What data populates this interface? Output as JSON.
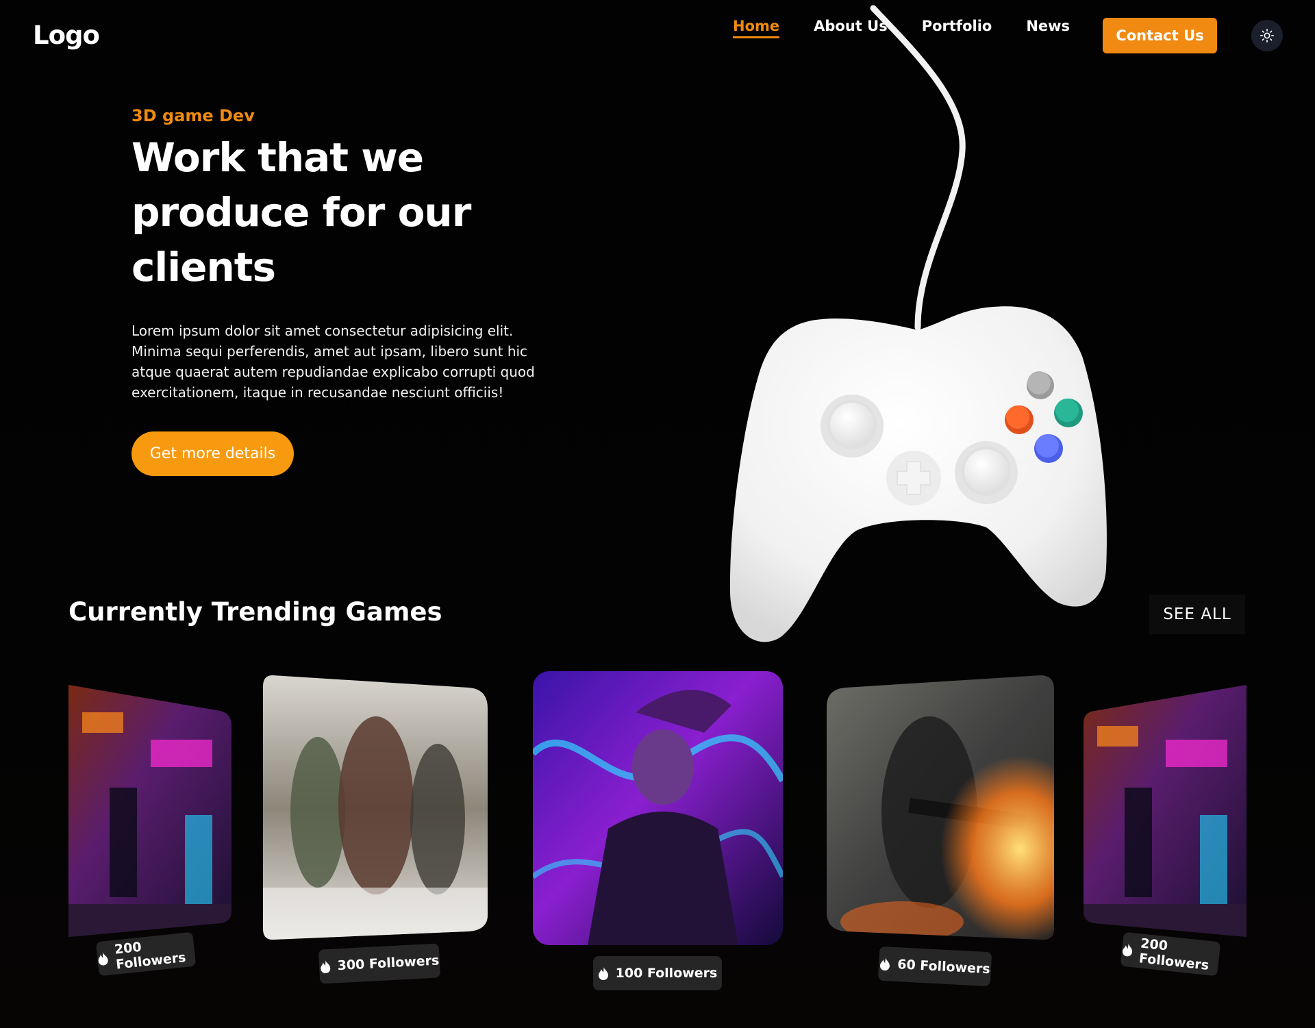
{
  "nav": {
    "logo": "Logo",
    "links": [
      {
        "label": "Home",
        "active": true
      },
      {
        "label": "About Us",
        "active": false
      },
      {
        "label": "Portfolio",
        "active": false
      },
      {
        "label": "News",
        "active": false
      }
    ],
    "contact_label": "Contact Us",
    "theme_icon": "sun-icon"
  },
  "hero": {
    "eyebrow": "3D game Dev",
    "title": "Work that we produce for our clients",
    "text": "Lorem ipsum dolor sit amet consectetur adipisicing elit. Minima sequi perferendis, amet aut ipsam, libero sunt hic atque quaerat autem repudiandae explicabo corrupti quod exercitationem, itaque in recusandae nesciunt officiis!",
    "cta_label": "Get more details"
  },
  "trending": {
    "title": "Currently Trending Games",
    "see_all": "SEE ALL",
    "cards": [
      {
        "followers": "200 Followers",
        "theme": "neon-city"
      },
      {
        "followers": "300 Followers",
        "theme": "warriors"
      },
      {
        "followers": "100 Followers",
        "theme": "neon-character"
      },
      {
        "followers": "60 Followers",
        "theme": "soldier"
      },
      {
        "followers": "200 Followers",
        "theme": "neon-city"
      }
    ]
  },
  "colors": {
    "accent": "#f08a12",
    "cta": "#f89a10",
    "background": "#030303",
    "badge": "#262626"
  }
}
